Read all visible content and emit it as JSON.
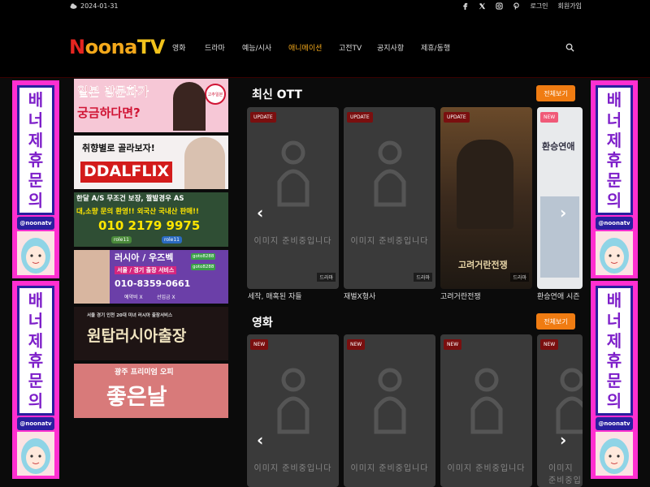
{
  "topbar": {
    "date": "2024-01-31",
    "login": "로그인",
    "signup": "회원가입"
  },
  "header": {
    "logo": {
      "n": "N",
      "oo": "oona",
      "tv": "TV"
    },
    "nav": [
      "영화",
      "드라마",
      "예능/시사",
      "애니메이션",
      "고전TV",
      "공지사항",
      "제휴/동행"
    ],
    "nav_active_color": "#f3a81b"
  },
  "side_banner": {
    "chars": [
      "배",
      "너",
      "제",
      "휴",
      "문",
      "의"
    ],
    "handle": "@noonatv"
  },
  "ads": [
    {
      "lines": [
        "일본 방문화가",
        "궁금하다면?"
      ],
      "badge": "고추일본"
    },
    {
      "lines": [
        "취향별로 골라보자!",
        "DDALFLIX"
      ]
    },
    {
      "lines": [
        "한달 A/S 무조건 보장, 짤발경우 AS",
        "대,소량 문의 환영!! 외국산 국내산 판매!!",
        "010 2179 9975"
      ],
      "tags": [
        "role11",
        "role11"
      ]
    },
    {
      "lines": [
        "러시아 / 우즈벡",
        "서울 / 경기 출장 서비스",
        "010-8359-0661"
      ],
      "tags": [
        "goto8288",
        "goto8288",
        "예약비 X",
        "선입금 X"
      ]
    },
    {
      "lines": [
        "서울 경기 인천 20대 미녀 러시아 출장서비스",
        "원탑러시아출장"
      ]
    },
    {
      "lines": [
        "광주 프리미엄 오피",
        "좋은날"
      ]
    }
  ],
  "sections": [
    {
      "title": "최신 OTT",
      "view_all": "전체보기",
      "cards": [
        {
          "badge": "UPDATE",
          "noimg": "이미지 준비중입니다",
          "genre": "드라마",
          "caption": "세작, 매혹된 자들"
        },
        {
          "badge": "UPDATE",
          "noimg": "이미지 준비중입니다",
          "genre": "드라마",
          "caption": "재벌X형사"
        },
        {
          "badge": "UPDATE",
          "poster_title": "고려거란전쟁",
          "genre": "드라마",
          "caption": "고려거란전쟁"
        },
        {
          "badge": "NEW",
          "poster_title": "환승연애",
          "caption": "환승연애 시즌"
        }
      ]
    },
    {
      "title": "영화",
      "view_all": "전체보기",
      "cards": [
        {
          "badge": "NEW",
          "noimg": "이미지 준비중입니다"
        },
        {
          "badge": "NEW",
          "noimg": "이미지 준비중입니다"
        },
        {
          "badge": "NEW",
          "noimg": "이미지 준비중입니다"
        },
        {
          "badge": "NEW",
          "noimg": "이미지 준비중입니다"
        }
      ]
    }
  ],
  "icons": [
    "weather-icon",
    "facebook-icon",
    "twitter-icon",
    "instagram-icon",
    "pinterest-icon",
    "search-icon",
    "chevron-left-icon",
    "chevron-right-icon"
  ]
}
